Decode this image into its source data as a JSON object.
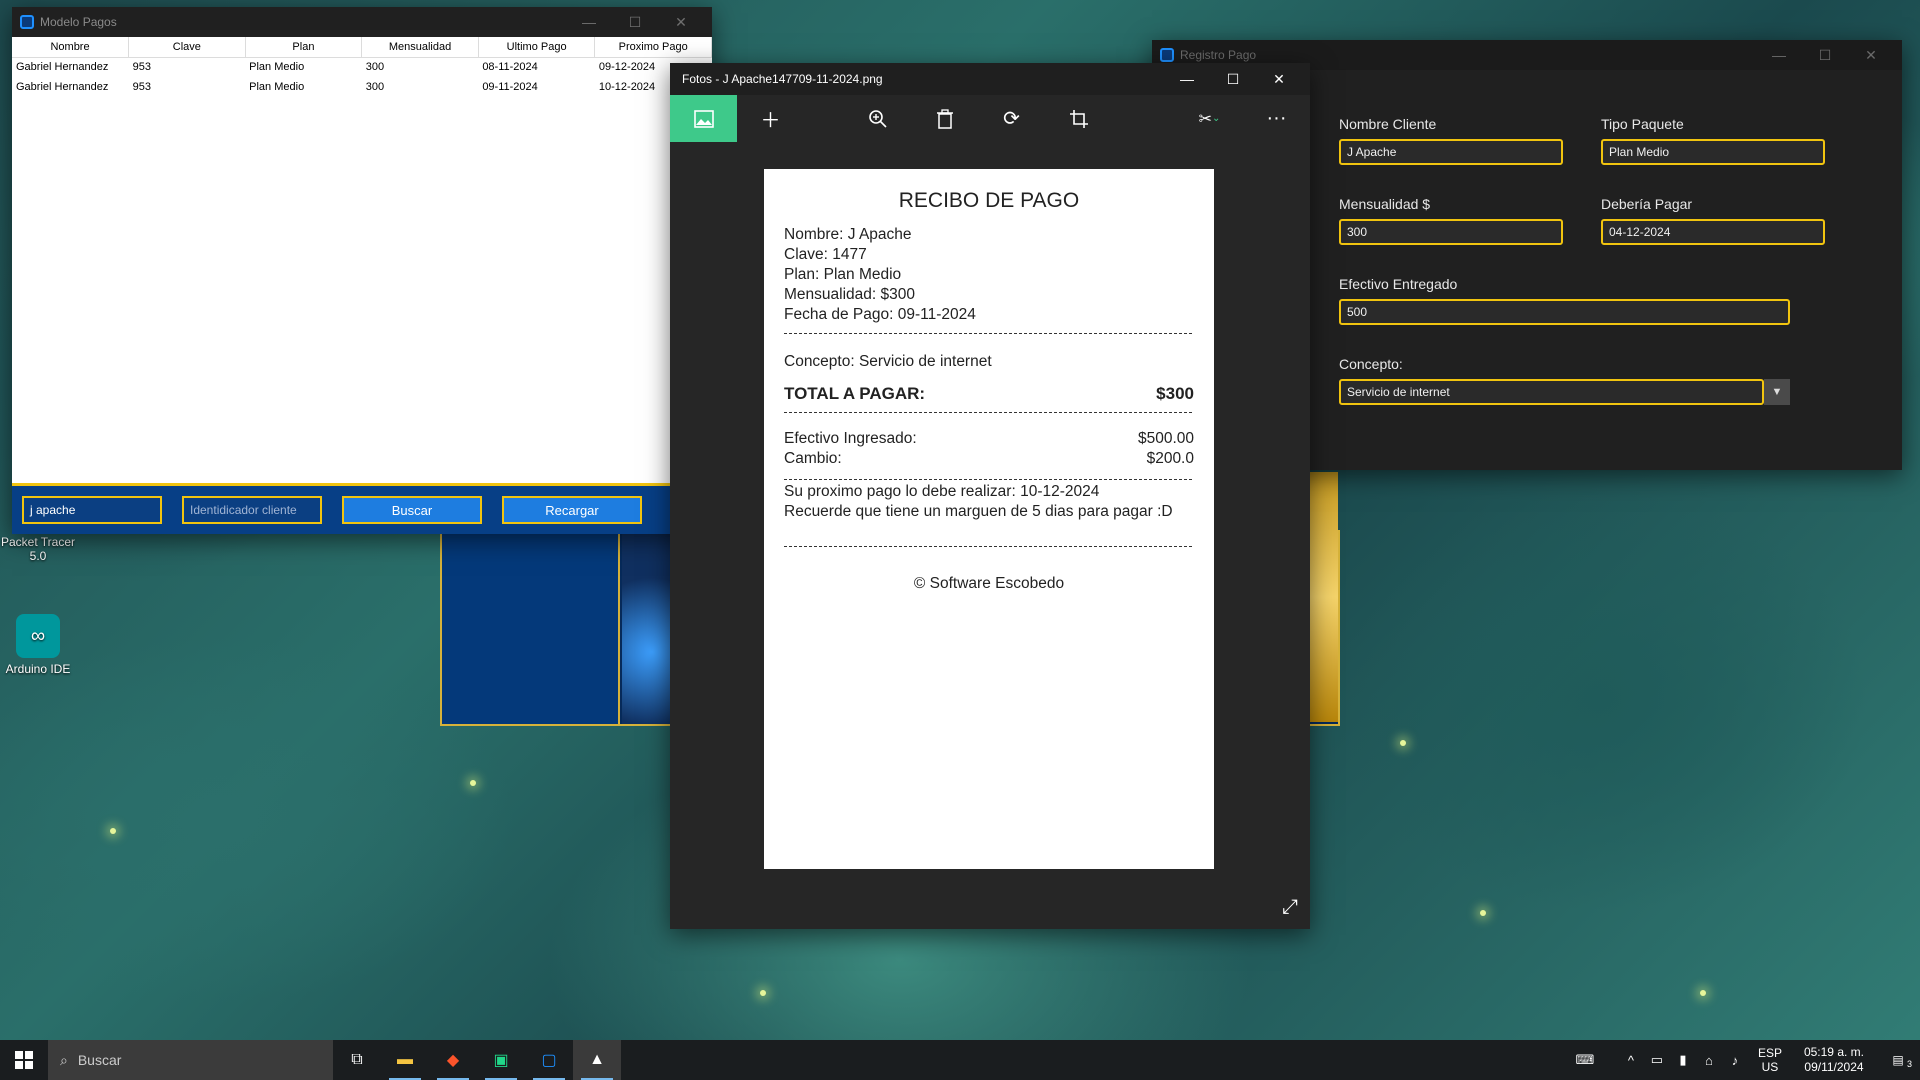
{
  "desktop": {
    "icons": [
      {
        "label": "Packet Tracer 5.0"
      },
      {
        "label": "Arduino IDE"
      }
    ]
  },
  "modelo_pagos": {
    "title": "Modelo Pagos",
    "columns": [
      "Nombre",
      "Clave",
      "Plan",
      "Mensualidad",
      "Ultimo Pago",
      "Proximo Pago"
    ],
    "rows": [
      [
        "Gabriel Hernandez",
        "953",
        "Plan Medio",
        "300",
        "08-11-2024",
        "09-12-2024"
      ],
      [
        "Gabriel Hernandez",
        "953",
        "Plan Medio",
        "300",
        "09-11-2024",
        "10-12-2024"
      ]
    ],
    "search_value": "j apache",
    "id_placeholder": "Identidicador cliente",
    "buscar_label": "Buscar",
    "recargar_label": "Recargar"
  },
  "registro_pago": {
    "title": "Registro Pago",
    "nombre_label": "Nombre Cliente",
    "nombre_value": "J Apache",
    "tipo_label": "Tipo Paquete",
    "tipo_value": "Plan Medio",
    "mensualidad_label": "Mensualidad $",
    "mensualidad_value": "300",
    "deberia_label": "Debería Pagar",
    "deberia_value": "04-12-2024",
    "efectivo_label": "Efectivo Entregado",
    "efectivo_value": "500",
    "concepto_label": "Concepto:",
    "concepto_value": "Servicio de internet"
  },
  "fotos": {
    "title": "Fotos - J Apache147709-11-2024.png",
    "toolbar": [
      "image-icon",
      "add-icon",
      "zoom-icon",
      "delete-icon",
      "rotate-icon",
      "crop-icon",
      "edit-icon",
      "more-icon"
    ]
  },
  "receipt": {
    "title": "RECIBO DE PAGO",
    "nombre": "Nombre: J Apache",
    "clave": "Clave: 1477",
    "plan": "Plan: Plan Medio",
    "mensualidad": "Mensualidad: $300",
    "fecha": "Fecha de Pago: 09-11-2024",
    "concepto": "Concepto: Servicio de internet",
    "total_label": "TOTAL A PAGAR:",
    "total_value": "$300",
    "efectivo_label": "Efectivo Ingresado:",
    "efectivo_value": "$500.00",
    "cambio_label": "Cambio:",
    "cambio_value": "$200.0",
    "proximo": "Su proximo pago lo debe realizar: 10-12-2024",
    "recuerde": "Recuerde que tiene un marguen de 5 dias para pagar :D",
    "footer": "© Software Escobedo"
  },
  "taskbar": {
    "search_placeholder": "Buscar",
    "lang_top": "ESP",
    "lang_bottom": "US",
    "time": "05:19 a. m.",
    "date": "09/11/2024",
    "notif_count": "3"
  }
}
